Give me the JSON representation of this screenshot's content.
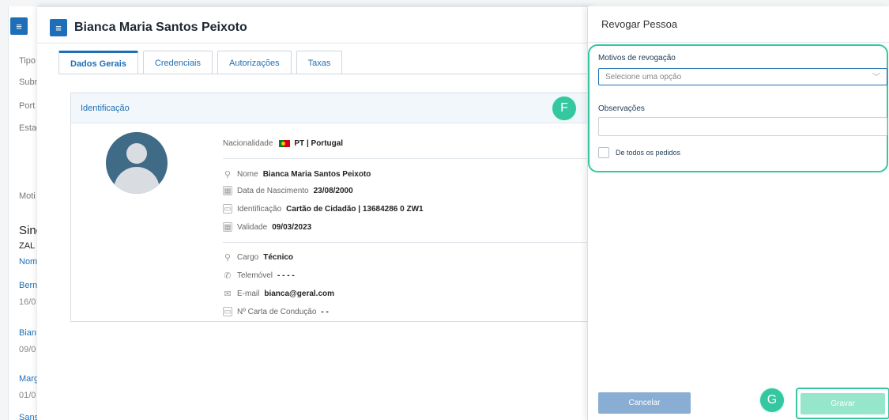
{
  "background": {
    "labels": [
      "Tipo",
      "Subm",
      "Port",
      "Estad",
      "Moti"
    ],
    "big_text": "Sine",
    "code": "ZAL",
    "col_header": "Nom",
    "rows": [
      {
        "name": "Bern",
        "date": "16/0"
      },
      {
        "name": "Bian",
        "date": "09/0"
      },
      {
        "name": "Marg",
        "date": "01/0"
      },
      {
        "name": "Sans",
        "date": ""
      }
    ]
  },
  "modal": {
    "title": "Bianca Maria Santos Peixoto",
    "tabs": [
      {
        "label": "Dados Gerais",
        "active": true
      },
      {
        "label": "Credenciais",
        "active": false
      },
      {
        "label": "Autorizações",
        "active": false
      },
      {
        "label": "Taxas",
        "active": false
      }
    ],
    "section_title": "Identificação",
    "nationality": {
      "label": "Nacionalidade",
      "value": "PT | Portugal"
    },
    "personal": [
      {
        "icon": "person-icon",
        "label": "Nome",
        "value": "Bianca Maria Santos Peixoto"
      },
      {
        "icon": "calendar-icon",
        "label": "Data de Nascimento",
        "value": "23/08/2000"
      },
      {
        "icon": "id-card-icon",
        "label": "Identificação",
        "value": "Cartão de Cidadão | 13684286 0 ZW1"
      },
      {
        "icon": "calendar-icon",
        "label": "Validade",
        "value": "09/03/2023"
      }
    ],
    "contacts": [
      {
        "icon": "person-icon",
        "label": "Cargo",
        "value": "Técnico"
      },
      {
        "icon": "phone-icon",
        "label": "Telemóvel",
        "value": "- - - -"
      },
      {
        "icon": "mail-icon",
        "label": "E-mail",
        "value": "bianca@geral.com"
      },
      {
        "icon": "id-card-icon",
        "label": "Nº Carta de Condução",
        "value": "- -"
      }
    ]
  },
  "badges": {
    "f": "F",
    "g": "G"
  },
  "panel": {
    "title": "Revogar Pessoa",
    "reason_label": "Motivos de revogação",
    "reason_placeholder": "Selecione uma opção",
    "notes_label": "Observações",
    "notes_value": "",
    "all_requests_label": "De todos os pedidos",
    "cancel_label": "Cancelar",
    "save_label": "Gravar"
  },
  "colors": {
    "primary": "#1e6fb7",
    "highlight": "#34c7a0",
    "save_bg": "#96e6cc",
    "cancel_bg": "#8aaed3"
  }
}
